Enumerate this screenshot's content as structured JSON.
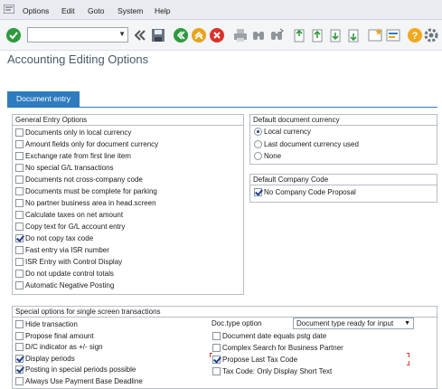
{
  "menu": [
    "Options",
    "Edit",
    "Goto",
    "System",
    "Help"
  ],
  "toolbar": {
    "icons": [
      "enter-icon",
      "back-icon",
      "save-icon",
      "exit-icon",
      "cancel-icon",
      "print-icon",
      "find-icon",
      "find-next-icon",
      "first-page-icon",
      "prev-page-icon",
      "next-page-icon",
      "last-page-icon",
      "create-shortcut-icon",
      "customize-layout-icon",
      "help-icon",
      "settings-icon"
    ]
  },
  "page_title": "Accounting Editing Options",
  "tabs": [
    {
      "label": "Document entry"
    }
  ],
  "general": {
    "title": "General Entry Options",
    "options": [
      {
        "label": "Documents only in local currency",
        "checked": false
      },
      {
        "label": "Amount fields only for document currency",
        "checked": false
      },
      {
        "label": "Exchange rate from first line item",
        "checked": false
      },
      {
        "label": "No special G/L transactions",
        "checked": false
      },
      {
        "label": "Documents not cross-company code",
        "checked": false
      },
      {
        "label": "Documents must be complete for parking",
        "checked": false
      },
      {
        "label": "No partner business area in head.screen",
        "checked": false
      },
      {
        "label": "Calculate taxes on net amount",
        "checked": false
      },
      {
        "label": "Copy text for G/L account entry",
        "checked": false
      },
      {
        "label": "Do not copy tax code",
        "checked": true
      },
      {
        "label": "Fast entry via ISR number",
        "checked": false
      },
      {
        "label": "ISR Entry with Control Display",
        "checked": false
      },
      {
        "label": "Do not update control totals",
        "checked": false
      },
      {
        "label": "Automatic Negative Posting",
        "checked": false
      }
    ]
  },
  "currency": {
    "title": "Default document currency",
    "options": [
      {
        "label": "Local currency",
        "selected": true
      },
      {
        "label": "Last document currency used",
        "selected": false
      },
      {
        "label": "None",
        "selected": false
      }
    ]
  },
  "company": {
    "title": "Default Company Code",
    "option": {
      "label": "No Company Code Proposal",
      "checked": true
    }
  },
  "special": {
    "title": "Special options for single screen transactions",
    "left": [
      {
        "label": "Hide transaction",
        "checked": false
      },
      {
        "label": "Propose final amount",
        "checked": false
      },
      {
        "label": "D/C indicator as +/- sign",
        "checked": false
      },
      {
        "label": "Display periods",
        "checked": true
      },
      {
        "label": "Posting in special periods possible",
        "checked": true
      },
      {
        "label": "Always Use Payment Base Deadline",
        "checked": false
      }
    ],
    "doctype_label": "Doc.type option",
    "doctype_value": "Document type ready for input",
    "right": [
      {
        "label": "Document date equals pstg date",
        "checked": false
      },
      {
        "label": "Complex Search for Business Partner",
        "checked": false
      },
      {
        "label": "Propose Last Tax Code",
        "checked": true
      },
      {
        "label": "Tax Code: Only Display Short Text",
        "checked": false
      }
    ]
  },
  "colors": {
    "accent": "#2f7bbf",
    "checkmark": "#1f3f8f",
    "title": "#4a5967"
  }
}
